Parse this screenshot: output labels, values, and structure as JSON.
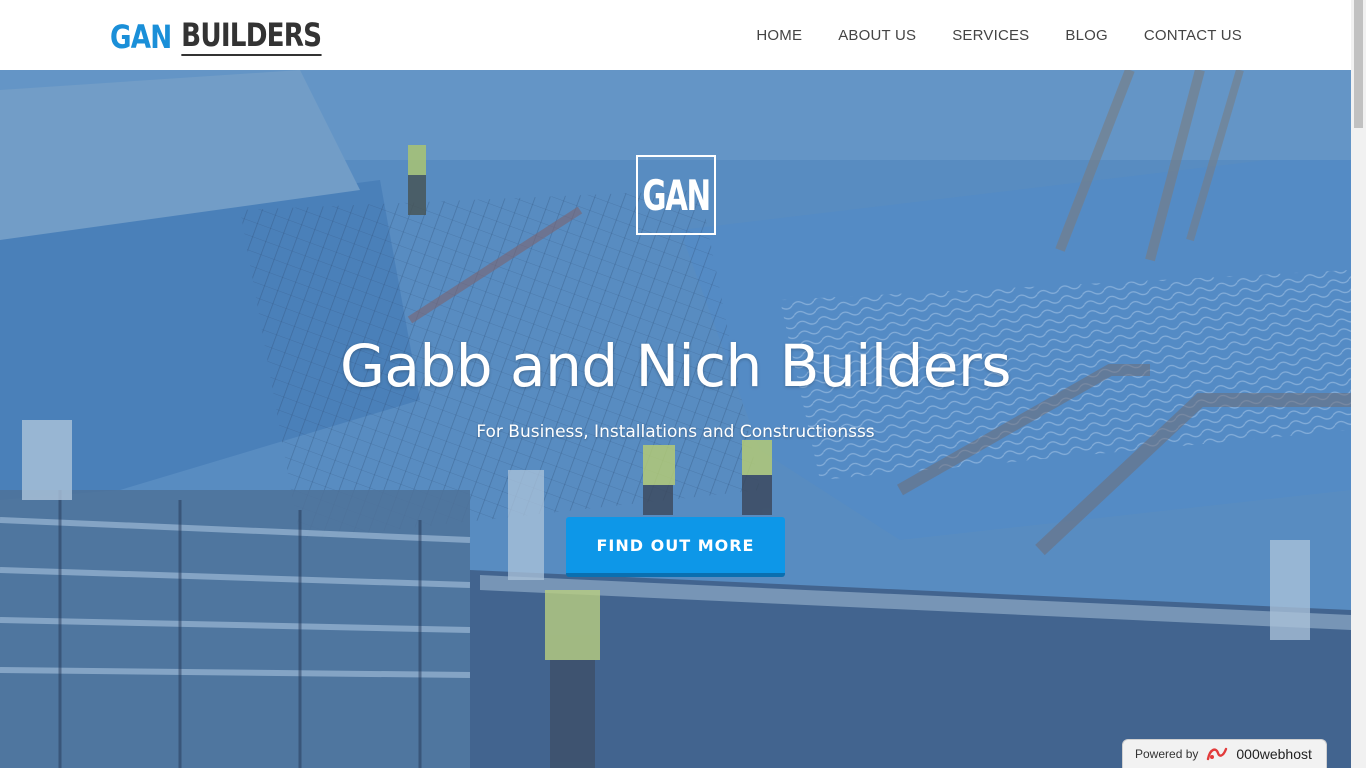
{
  "header": {
    "logo_part1": "GAN",
    "logo_part2": "BUILDERS",
    "nav": [
      "HOME",
      "ABOUT US",
      "SERVICES",
      "BLOG",
      "CONTACT US"
    ]
  },
  "hero": {
    "badge": "GAN",
    "title": "Gabb and Nich Builders",
    "subtitle": "For Business, Installations and Constructionsss",
    "cta_label": "FIND OUT MORE"
  },
  "footer_badge": {
    "prefix": "Powered by",
    "brand": "000webhost"
  },
  "colors": {
    "accent": "#1a8fd8",
    "cta": "#0d97e8",
    "hero_tint": "#4f8fcf"
  }
}
